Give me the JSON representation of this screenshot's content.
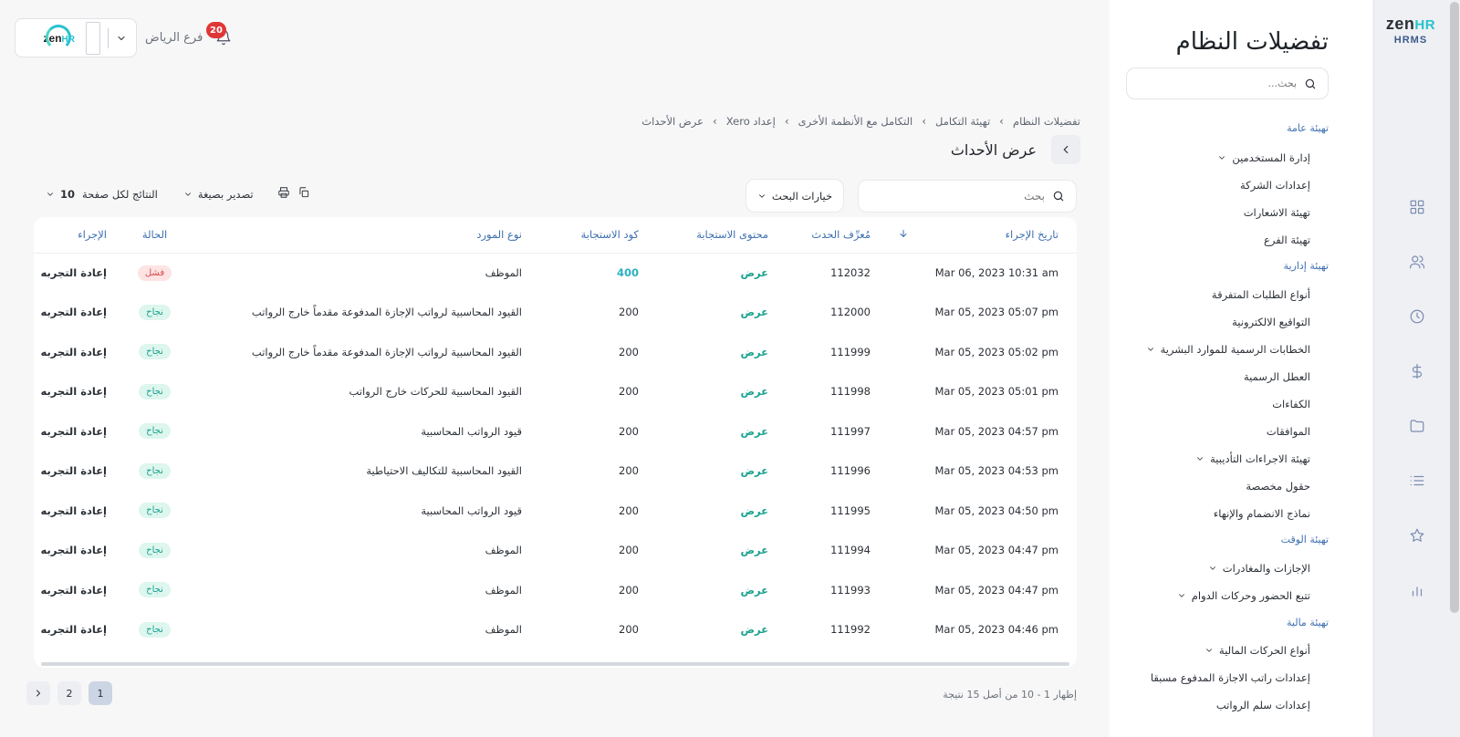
{
  "app": {
    "logo_text": "zenHR",
    "logo_sub": "HRMS"
  },
  "header": {
    "branch": "فرع الرياض",
    "notifications_count": "20",
    "company_logo": "zenHR"
  },
  "settings_panel": {
    "title": "تفضيلات النظام",
    "search_placeholder": "بحث...",
    "items": [
      {
        "label": "تهيئة عامة",
        "type": "section"
      },
      {
        "label": "إدارة المستخدمين",
        "type": "item",
        "chevron": true
      },
      {
        "label": "إعدادات الشركة",
        "type": "item"
      },
      {
        "label": "تهيئة الاشعارات",
        "type": "item"
      },
      {
        "label": "تهيئة الفرع",
        "type": "item"
      },
      {
        "label": "تهيئة إدارية",
        "type": "section"
      },
      {
        "label": "أنواع الطلبات المتفرقة",
        "type": "item"
      },
      {
        "label": "التواقيع الالكترونية",
        "type": "item"
      },
      {
        "label": "الخطابات الرسمية للموارد البشرية",
        "type": "item",
        "chevron": true
      },
      {
        "label": "العطل الرسمية",
        "type": "item"
      },
      {
        "label": "الكفاءات",
        "type": "item"
      },
      {
        "label": "الموافقات",
        "type": "item"
      },
      {
        "label": "تهيئة الاجراءات التأديبية",
        "type": "item",
        "chevron": true
      },
      {
        "label": "حقول مخصصة",
        "type": "item"
      },
      {
        "label": "نماذج الانضمام والإنهاء",
        "type": "item"
      },
      {
        "label": "تهيئة الوقت",
        "type": "section"
      },
      {
        "label": "الإجازات والمغادرات",
        "type": "item",
        "chevron": true
      },
      {
        "label": "تتبع الحضور وحركات الدوام",
        "type": "item",
        "chevron": true
      },
      {
        "label": "تهيئة مالية",
        "type": "section"
      },
      {
        "label": "أنواع الحركات المالية",
        "type": "item",
        "chevron": true
      },
      {
        "label": "إعدادات راتب الاجازة المدفوع مسبقا",
        "type": "item"
      },
      {
        "label": "إعدادات سلم الرواتب",
        "type": "item"
      }
    ]
  },
  "breadcrumb": [
    "تفضيلات النظام",
    "تهيئة التكامل",
    "التكامل مع الأنظمة الأخرى",
    "إعداد Xero",
    "عرض الأحداث"
  ],
  "page": {
    "title": "عرض الأحداث",
    "search_placeholder": "بحث",
    "search_options_label": "خيارات البحث",
    "export_label": "تصدير بصيغة",
    "per_page_label": "النتائج لكل صفحة",
    "per_page_value": "10"
  },
  "table": {
    "columns": [
      "تاريخ الإجراء",
      "مُعرِّف الحدث",
      "محتوى الاستجابة",
      "كود الاستجابة",
      "نوع المورد",
      "الحالة",
      "الإجراء"
    ],
    "rows": [
      {
        "date": "Mar 06, 2023 10:31 am",
        "id": "112032",
        "content": "عرض",
        "code": "400",
        "resource": "الموظف",
        "status": "فشل",
        "status_kind": "fail",
        "action": "إعادة التجربه"
      },
      {
        "date": "Mar 05, 2023 05:07 pm",
        "id": "112000",
        "content": "عرض",
        "code": "200",
        "resource": "القيود المحاسبية لرواتب الإجازة المدفوعة مقدماً خارج الرواتب",
        "status": "نجاح",
        "status_kind": "ok",
        "action": "إعادة التجربه"
      },
      {
        "date": "Mar 05, 2023 05:02 pm",
        "id": "111999",
        "content": "عرض",
        "code": "200",
        "resource": "القيود المحاسبية لرواتب الإجازة المدفوعة مقدماً خارج الرواتب",
        "status": "نجاح",
        "status_kind": "ok",
        "action": "إعادة التجربه"
      },
      {
        "date": "Mar 05, 2023 05:01 pm",
        "id": "111998",
        "content": "عرض",
        "code": "200",
        "resource": "القيود المحاسبية للحركات خارج الرواتب",
        "status": "نجاح",
        "status_kind": "ok",
        "action": "إعادة التجربه"
      },
      {
        "date": "Mar 05, 2023 04:57 pm",
        "id": "111997",
        "content": "عرض",
        "code": "200",
        "resource": "قيود الرواتب المحاسبية",
        "status": "نجاح",
        "status_kind": "ok",
        "action": "إعادة التجربه"
      },
      {
        "date": "Mar 05, 2023 04:53 pm",
        "id": "111996",
        "content": "عرض",
        "code": "200",
        "resource": "القيود المحاسبية للتكاليف الاحتياطية",
        "status": "نجاح",
        "status_kind": "ok",
        "action": "إعادة التجربه"
      },
      {
        "date": "Mar 05, 2023 04:50 pm",
        "id": "111995",
        "content": "عرض",
        "code": "200",
        "resource": "قيود الرواتب المحاسبية",
        "status": "نجاح",
        "status_kind": "ok",
        "action": "إعادة التجربه"
      },
      {
        "date": "Mar 05, 2023 04:47 pm",
        "id": "111994",
        "content": "عرض",
        "code": "200",
        "resource": "الموظف",
        "status": "نجاح",
        "status_kind": "ok",
        "action": "إعادة التجربه"
      },
      {
        "date": "Mar 05, 2023 04:47 pm",
        "id": "111993",
        "content": "عرض",
        "code": "200",
        "resource": "الموظف",
        "status": "نجاح",
        "status_kind": "ok",
        "action": "إعادة التجربه"
      },
      {
        "date": "Mar 05, 2023 04:46 pm",
        "id": "111992",
        "content": "عرض",
        "code": "200",
        "resource": "الموظف",
        "status": "نجاح",
        "status_kind": "ok",
        "action": "إعادة التجربه"
      }
    ]
  },
  "pagination": {
    "pages": [
      "1",
      "2"
    ],
    "current": "1",
    "info": "إظهار 1 - 10 من أصل 15 نتيجة"
  },
  "colors": {
    "accent": "#3d6fb0",
    "success": "#1aa28f",
    "danger": "#e03636",
    "brand": "#29c2cf"
  }
}
